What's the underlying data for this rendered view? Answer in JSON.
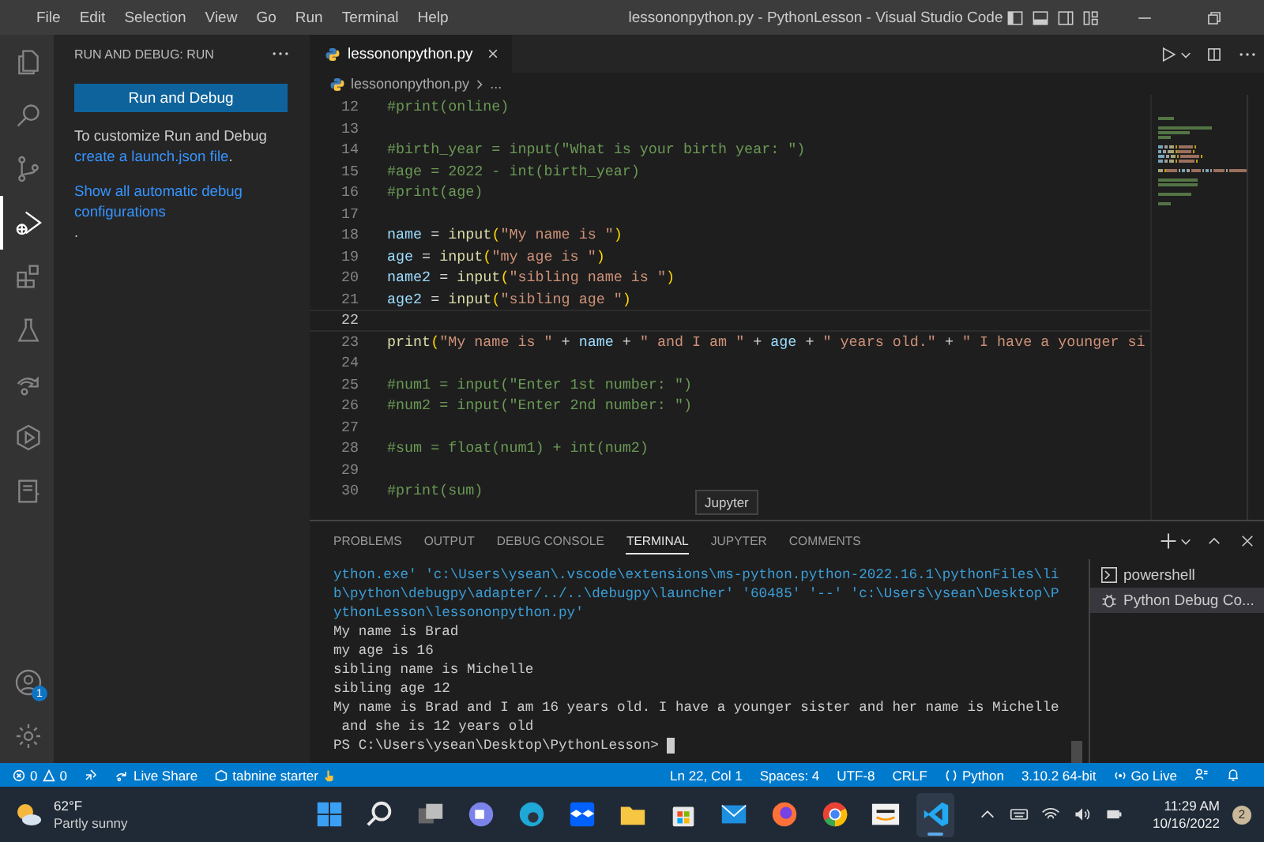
{
  "title_bar": {
    "menu": [
      "File",
      "Edit",
      "Selection",
      "View",
      "Go",
      "Run",
      "Terminal",
      "Help"
    ],
    "title": "lessononpython.py - PythonLesson - Visual Studio Code"
  },
  "activity_bar": {
    "items": [
      {
        "kind": "files",
        "selected": false
      },
      {
        "kind": "search",
        "selected": false
      },
      {
        "kind": "source-control",
        "selected": false
      },
      {
        "kind": "run-debug",
        "selected": true
      },
      {
        "kind": "extensions",
        "selected": false
      },
      {
        "kind": "testing",
        "selected": false
      },
      {
        "kind": "live-share",
        "selected": false
      },
      {
        "kind": "play-hex",
        "selected": false
      },
      {
        "kind": "notebook",
        "selected": false
      }
    ],
    "account_badge": "1"
  },
  "sidebar": {
    "title": "RUN AND DEBUG: RUN",
    "button": "Run and Debug",
    "intro": "To customize Run and Debug",
    "link": "create a launch.json file",
    "link_after": ".",
    "more_link": "Show all automatic debug configurations",
    "more_after": "."
  },
  "editor": {
    "tab": {
      "label": "lessononpython.py",
      "selected": true
    },
    "breadcrumb": [
      "lessononpython.py",
      "..."
    ],
    "lines": [
      {
        "number": "12",
        "tokens": [
          {
            "kind": "comment",
            "text": "#print(online)"
          }
        ]
      },
      {
        "number": "13"
      },
      {
        "number": "14",
        "tokens": [
          {
            "kind": "comment",
            "text": "#birth_year = input(\"What is your birth year: \")"
          }
        ]
      },
      {
        "number": "15",
        "tokens": [
          {
            "kind": "comment",
            "text": "#age = 2022 - int(birth_year)"
          }
        ]
      },
      {
        "number": "16",
        "tokens": [
          {
            "kind": "comment",
            "text": "#print(age)"
          }
        ]
      },
      {
        "number": "17"
      },
      {
        "number": "18",
        "tokens": [
          {
            "kind": "var",
            "text": "name"
          },
          {
            "kind": "plain",
            "text": " = "
          },
          {
            "kind": "func",
            "text": "input"
          },
          {
            "kind": "bracket",
            "text": "("
          },
          {
            "kind": "str",
            "text": "\"My name is \""
          },
          {
            "kind": "bracket",
            "text": ")"
          }
        ]
      },
      {
        "number": "19",
        "tokens": [
          {
            "kind": "var",
            "text": "age"
          },
          {
            "kind": "plain",
            "text": " = "
          },
          {
            "kind": "func",
            "text": "input"
          },
          {
            "kind": "bracket",
            "text": "("
          },
          {
            "kind": "str",
            "text": "\"my age is \""
          },
          {
            "kind": "bracket",
            "text": ")"
          }
        ]
      },
      {
        "number": "20",
        "tokens": [
          {
            "kind": "var",
            "text": "name2"
          },
          {
            "kind": "plain",
            "text": " = "
          },
          {
            "kind": "func",
            "text": "input"
          },
          {
            "kind": "bracket",
            "text": "("
          },
          {
            "kind": "str",
            "text": "\"sibling name is \""
          },
          {
            "kind": "bracket",
            "text": ")"
          }
        ]
      },
      {
        "number": "21",
        "tokens": [
          {
            "kind": "var",
            "text": "age2"
          },
          {
            "kind": "plain",
            "text": " = "
          },
          {
            "kind": "func",
            "text": "input"
          },
          {
            "kind": "bracket",
            "text": "("
          },
          {
            "kind": "str",
            "text": "\"sibling age \""
          },
          {
            "kind": "bracket",
            "text": ")"
          }
        ]
      },
      {
        "number": "22",
        "current": true
      },
      {
        "number": "23",
        "tokens": [
          {
            "kind": "func",
            "text": "print"
          },
          {
            "kind": "bracket",
            "text": "("
          },
          {
            "kind": "str",
            "text": "\"My name is \""
          },
          {
            "kind": "plain",
            "text": " + "
          },
          {
            "kind": "var",
            "text": "name"
          },
          {
            "kind": "plain",
            "text": " + "
          },
          {
            "kind": "str",
            "text": "\" and I am \""
          },
          {
            "kind": "plain",
            "text": " + "
          },
          {
            "kind": "var",
            "text": "age"
          },
          {
            "kind": "plain",
            "text": " + "
          },
          {
            "kind": "str",
            "text": "\" years old.\""
          },
          {
            "kind": "plain",
            "text": " + "
          },
          {
            "kind": "str",
            "text": "\" I have a younger si"
          }
        ]
      },
      {
        "number": "24"
      },
      {
        "number": "25",
        "tokens": [
          {
            "kind": "comment",
            "text": "#num1 = input(\"Enter 1st number: \")"
          }
        ]
      },
      {
        "number": "26",
        "tokens": [
          {
            "kind": "comment",
            "text": "#num2 = input(\"Enter 2nd number: \")"
          }
        ]
      },
      {
        "number": "27"
      },
      {
        "number": "28",
        "tokens": [
          {
            "kind": "comment",
            "text": "#sum = float(num1) + int(num2)"
          }
        ]
      },
      {
        "number": "29"
      },
      {
        "number": "30",
        "tokens": [
          {
            "kind": "comment",
            "text": "#print(sum)"
          }
        ]
      }
    ]
  },
  "tooltip": "Jupyter",
  "panel": {
    "tabs": [
      {
        "label": "PROBLEMS",
        "selected": false
      },
      {
        "label": "OUTPUT",
        "selected": false
      },
      {
        "label": "DEBUG CONSOLE",
        "selected": false
      },
      {
        "label": "TERMINAL",
        "selected": true
      },
      {
        "label": "JUPYTER",
        "selected": false
      },
      {
        "label": "COMMENTS",
        "selected": false
      }
    ],
    "terminal_lines": [
      {
        "kind": "command",
        "text": "ython.exe' 'c:\\Users\\ysean\\.vscode\\extensions\\ms-python.python-2022.16.1\\pythonFiles\\li"
      },
      {
        "kind": "command",
        "text": "b\\python\\debugpy\\adapter/../..\\debugpy\\launcher' '60485' '--' 'c:\\Users\\ysean\\Desktop\\P"
      },
      {
        "kind": "command",
        "text": "ythonLesson\\lessononpython.py'"
      },
      {
        "kind": "output",
        "text": "My name is Brad"
      },
      {
        "kind": "output",
        "text": "my age is 16"
      },
      {
        "kind": "output",
        "text": "sibling name is Michelle"
      },
      {
        "kind": "output",
        "text": "sibling age 12"
      },
      {
        "kind": "output",
        "text": "My name is Brad and I am 16 years old. I have a younger sister and her name is Michelle"
      },
      {
        "kind": "output",
        "text": " and she is 12 years old"
      },
      {
        "kind": "prompt",
        "text": "PS C:\\Users\\ysean\\Desktop\\PythonLesson> "
      }
    ],
    "terminals": [
      {
        "kind": "shell",
        "name": "powershell",
        "selected": false
      },
      {
        "kind": "debug",
        "name": "Python Debug Co...",
        "selected": true
      }
    ]
  },
  "status_bar": {
    "errors": "0",
    "warnings": "0",
    "left": [
      {
        "kind": "liveshare",
        "text": "Live Share"
      },
      {
        "kind": "tabnine",
        "text": "tabnine starter"
      }
    ],
    "right": [
      {
        "kind": "plain",
        "text": "Ln 22, Col 1"
      },
      {
        "kind": "plain",
        "text": "Spaces: 4"
      },
      {
        "kind": "plain",
        "text": "UTF-8"
      },
      {
        "kind": "plain",
        "text": "CRLF"
      },
      {
        "kind": "python",
        "text": "Python"
      },
      {
        "kind": "plain",
        "text": "3.10.2 64-bit"
      },
      {
        "kind": "golive",
        "text": "Go Live"
      }
    ]
  },
  "taskbar": {
    "temperature": "62°F",
    "weather": "Partly sunny",
    "apps": [
      {
        "kind": "start",
        "active": false
      },
      {
        "kind": "search",
        "active": false
      },
      {
        "kind": "task-view",
        "active": false
      },
      {
        "kind": "chat",
        "active": false
      },
      {
        "kind": "edge",
        "active": false
      },
      {
        "kind": "dropbox",
        "active": false
      },
      {
        "kind": "folder",
        "active": false
      },
      {
        "kind": "store",
        "active": false
      },
      {
        "kind": "mail",
        "active": false
      },
      {
        "kind": "firefox",
        "active": false
      },
      {
        "kind": "chrome",
        "active": false
      },
      {
        "kind": "amazon",
        "active": false
      },
      {
        "kind": "vscode",
        "active": true
      }
    ],
    "time": "11:29 AM",
    "date": "10/16/2022",
    "notifications": "2"
  }
}
